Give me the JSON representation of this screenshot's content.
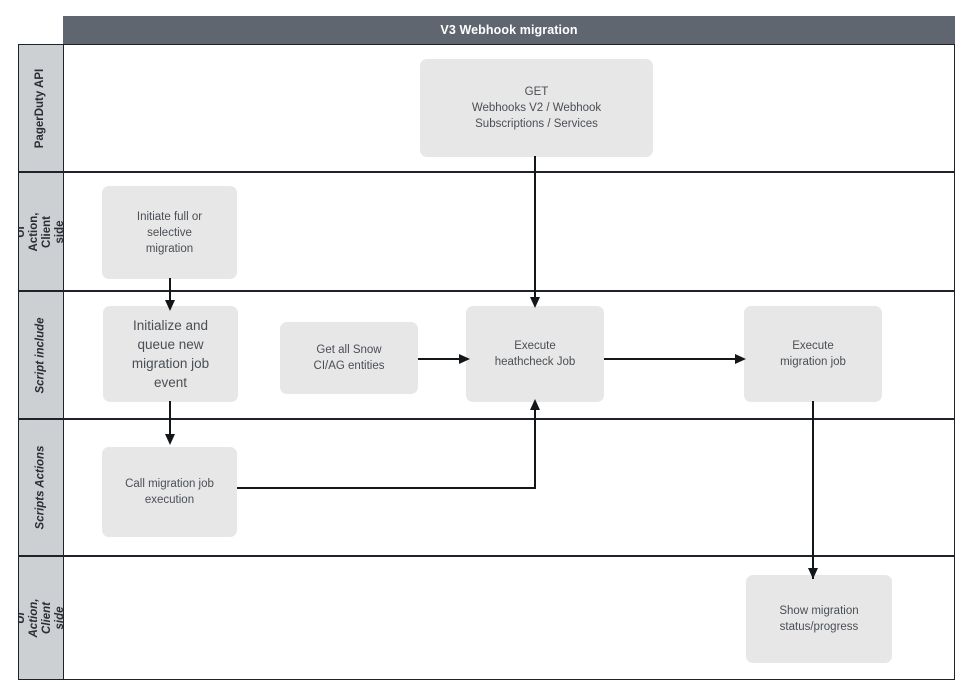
{
  "diagram": {
    "title": "V3 Webhook migration",
    "title_bar_color": "#5f6670",
    "lane_header_color": "#cdd0d3",
    "node_color": "#e7e7e7",
    "border_color": "#1f2329",
    "lanes": [
      {
        "id": "pagerduty-api",
        "label": "PagerDuty API",
        "italic": false
      },
      {
        "id": "ui-action-client-side-top",
        "label": "UI Action, Client side",
        "italic": false
      },
      {
        "id": "script-include",
        "label": "Script include",
        "italic": true
      },
      {
        "id": "scripts-actions",
        "label": "Scripts Actions",
        "italic": true
      },
      {
        "id": "ui-action-client-side-bottom",
        "label": "UI Action, Client side",
        "italic": true
      }
    ],
    "nodes": [
      {
        "id": "get-webhooks",
        "lane": "pagerduty-api",
        "label": "GET\nWebhooks V2 / Webhook\nSubscriptions / Services"
      },
      {
        "id": "initiate-migration",
        "lane": "ui-action-client-side-top",
        "label": "Initiate full or\nselective\nmigration"
      },
      {
        "id": "initialize-queue-job",
        "lane": "script-include",
        "label": "Initialize and\nqueue new\nmigration job\nevent"
      },
      {
        "id": "get-snow-entities",
        "lane": "script-include",
        "label": "Get all Snow\nCI/AG entities"
      },
      {
        "id": "execute-heathcheck",
        "lane": "script-include",
        "label": "Execute\nheathcheck Job"
      },
      {
        "id": "execute-migration-job",
        "lane": "script-include",
        "label": "Execute\nmigration job"
      },
      {
        "id": "call-migration-execution",
        "lane": "scripts-actions",
        "label": "Call migration job\nexecution"
      },
      {
        "id": "show-migration-status",
        "lane": "ui-action-client-side-bottom",
        "label": "Show migration\nstatus/progress"
      }
    ],
    "edges": [
      {
        "id": "edge-get-webhooks-to-heathcheck",
        "from": "get-webhooks",
        "to": "execute-heathcheck",
        "direction": "down"
      },
      {
        "id": "edge-initiate-to-initialize",
        "from": "initiate-migration",
        "to": "initialize-queue-job",
        "direction": "down"
      },
      {
        "id": "edge-initialize-to-call",
        "from": "initialize-queue-job",
        "to": "call-migration-execution",
        "direction": "down"
      },
      {
        "id": "edge-call-to-heathcheck",
        "from": "call-migration-execution",
        "to": "execute-heathcheck",
        "direction": "up"
      },
      {
        "id": "edge-snow-to-heathcheck",
        "from": "get-snow-entities",
        "to": "execute-heathcheck",
        "direction": "right"
      },
      {
        "id": "edge-heathcheck-to-migration",
        "from": "execute-heathcheck",
        "to": "execute-migration-job",
        "direction": "right"
      },
      {
        "id": "edge-migration-to-status",
        "from": "execute-migration-job",
        "to": "show-migration-status",
        "direction": "down"
      }
    ]
  }
}
